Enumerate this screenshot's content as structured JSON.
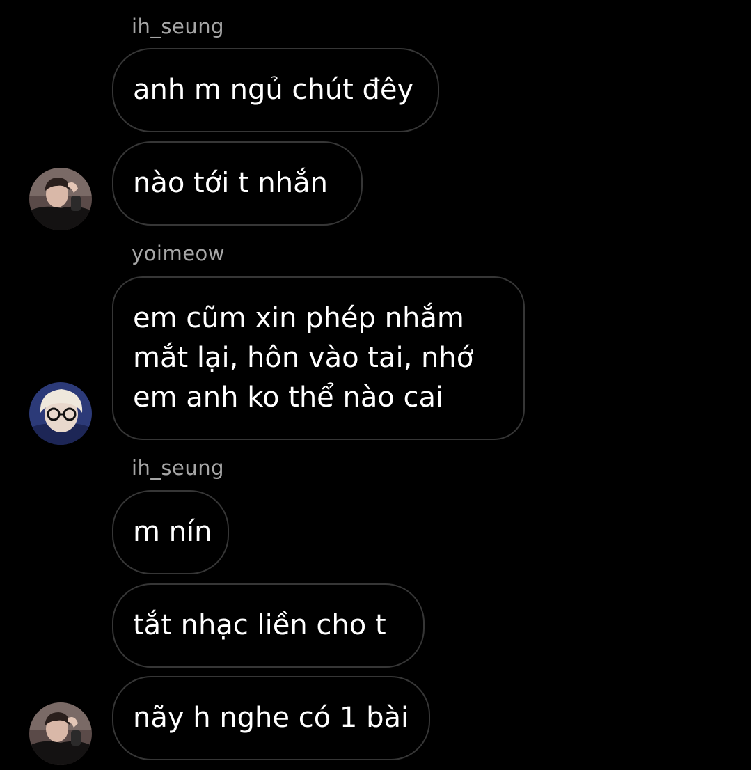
{
  "messages": [
    {
      "sender": "ih_seung",
      "bubbles": [
        "anh m ngủ chút đêy",
        "nào tới t nhắn"
      ]
    },
    {
      "sender": "yoimeow",
      "bubbles": [
        [
          "em cũm xin phép nhắm",
          "mắt lại, hôn vào tai, nhớ",
          "em anh ko thể nào cai"
        ]
      ]
    },
    {
      "sender": "ih_seung",
      "bubbles": [
        "m nín",
        "tắt nhạc liền cho t",
        "nãy h nghe có 1 bài"
      ]
    }
  ],
  "avatars": {
    "ih_seung": "avatar-photo-dark-hair",
    "yoimeow": "avatar-photo-blonde-glasses"
  },
  "colors": {
    "background": "#000000",
    "bubble_border": "#363636",
    "sender_text": "#a6a6a6",
    "message_text": "#ffffff"
  }
}
